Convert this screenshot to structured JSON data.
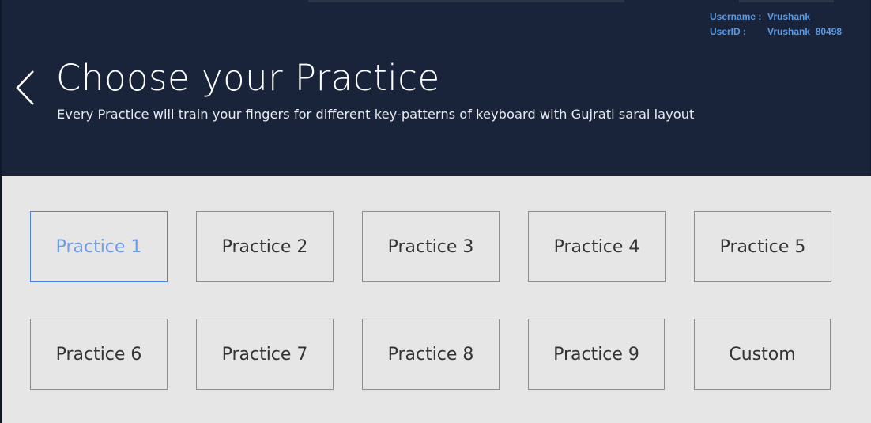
{
  "user": {
    "username_label": "Username :",
    "username_value": "Vrushank",
    "userid_label": "UserID :",
    "userid_value": "Vrushank_80498"
  },
  "header": {
    "back_icon": "chevron-left-icon",
    "title": "Choose your Practice",
    "subtitle": "Every Practice will train your fingers for different key-patterns of keyboard with Gujrati saral layout"
  },
  "practices": [
    {
      "label": "Practice 1",
      "selected": true
    },
    {
      "label": "Practice 2",
      "selected": false
    },
    {
      "label": "Practice 3",
      "selected": false
    },
    {
      "label": "Practice 4",
      "selected": false
    },
    {
      "label": "Practice 5",
      "selected": false
    },
    {
      "label": "Practice 6",
      "selected": false
    },
    {
      "label": "Practice 7",
      "selected": false
    },
    {
      "label": "Practice 8",
      "selected": false
    },
    {
      "label": "Practice 9",
      "selected": false
    },
    {
      "label": "Custom",
      "selected": false
    }
  ],
  "colors": {
    "header_bg": "#19233a",
    "page_bg": "#e6e6e6",
    "accent": "#4a82e0",
    "user_info": "#5a9be6"
  }
}
